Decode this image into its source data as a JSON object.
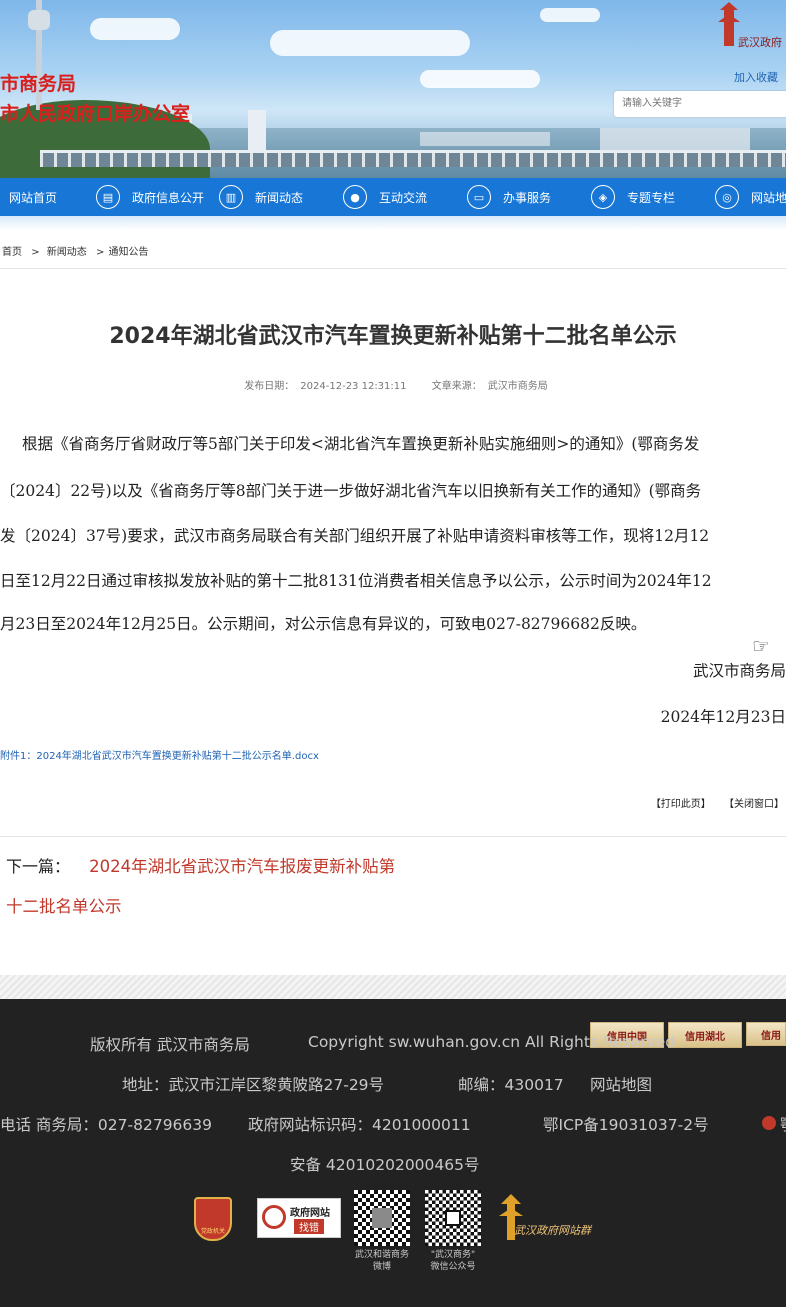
{
  "header": {
    "site_title_line1": "市商务局",
    "site_title_line2": "市人民政府口岸办公室",
    "favorite": "加入收藏",
    "search_placeholder": "请输入关键字",
    "logo_text": "武汉政府"
  },
  "nav": {
    "items": [
      {
        "label": "网站首页",
        "icon": "home-icon"
      },
      {
        "label": "政府信息公开",
        "icon": "document-icon"
      },
      {
        "label": "新闻动态",
        "icon": "news-icon"
      },
      {
        "label": "互动交流",
        "icon": "chat-icon"
      },
      {
        "label": "办事服务",
        "icon": "monitor-icon"
      },
      {
        "label": "专题专栏",
        "icon": "cube-icon"
      },
      {
        "label": "网站地图",
        "icon": "globe-icon"
      }
    ]
  },
  "breadcrumb": {
    "home": "首页",
    "sep1": ">",
    "news": "新闻动态",
    "sep2": ">",
    "current": "通知公告"
  },
  "article": {
    "title": "2024年湖北省武汉市汽车置换更新补贴第十二批名单公示",
    "publish_label": "发布日期：",
    "publish_date": "2024-12-23 12:31:11",
    "source_label": "文章来源：",
    "source": "武汉市商务局",
    "body_lines": [
      "根据《省商务厅省财政厅等5部门关于印发<湖北省汽车置换更新补贴实施细则>的通知》(鄂商务发",
      "〔2024〕22号)以及《省商务厅等8部门关于进一步做好湖北省汽车以旧换新有关工作的通知》(鄂商务",
      "发〔2024〕37号)要求，武汉市商务局联合有关部门组织开展了补贴申请资料审核等工作，现将12月12",
      "日至12月22日通过审核拟发放补贴的第十二批8131位消费者相关信息予以公示，公示时间为2024年12",
      "月23日至2024年12月25日。公示期间，对公示信息有异议的，可致电027-82796682反映。"
    ],
    "signature": "武汉市商务局",
    "sign_date": "2024年12月23日",
    "attachment": "附件1：2024年湖北省武汉市汽车置换更新补贴第十二批公示名单.docx",
    "print": "【打印此页】",
    "close": "【关闭窗口】",
    "next_label": "下一篇：",
    "next_title_line1": "2024年湖北省武汉市汽车报废更新补贴第",
    "next_title_line2": "十二批名单公示"
  },
  "footer": {
    "copyright": "版权所有 武汉市商务局",
    "copyright_en": "Copyright sw.wuhan.gov.cn All Rights Reserved",
    "address": "地址：武汉市江岸区黎黄陂路27-29号",
    "postcode": "邮编：430017",
    "sitemap": "网站地图",
    "phone": "电话 商务局：027-82796639",
    "site_id": "政府网站标识码：4201000011",
    "icp": "鄂ICP备19031037-2号",
    "police_badge_text": "鄂",
    "beian": "安备 42010202000465号",
    "credit_badges": [
      "信用中国",
      "信用湖北",
      "信用"
    ],
    "gov_error_line1": "政府网站",
    "gov_error_line2": "找错",
    "party_logo_text": "党政机关",
    "qr1_caption_line1": "武汉和谐商务",
    "qr1_caption_line2": "微博",
    "qr2_caption_line1": "\"武汉商务\"",
    "qr2_caption_line2": "微信公众号",
    "brand_text": "武汉政府网站群"
  }
}
